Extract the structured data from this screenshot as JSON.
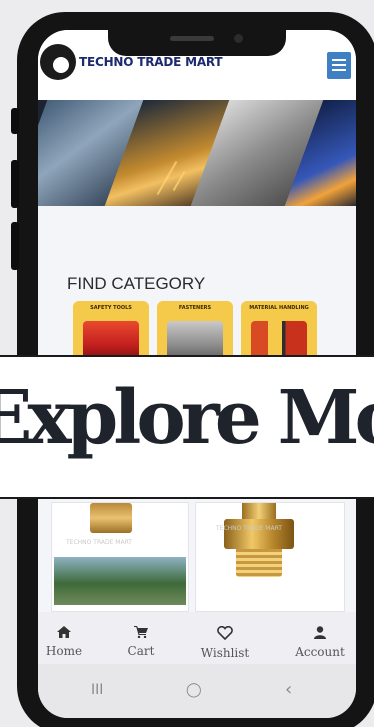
{
  "header": {
    "brand": "TECHNO TRADE MART",
    "logo_icon": "gear-logo-icon",
    "menu_icon": "hamburger-icon"
  },
  "banner": {
    "description_icon": "industrial-banner"
  },
  "categories": {
    "title": "FIND CATEGORY",
    "items": [
      {
        "label": "SAFETY TOOLS"
      },
      {
        "label": "FASTENERS"
      },
      {
        "label": "MATERIAL HANDLING"
      }
    ]
  },
  "products": {
    "watermark": "TECHNO TRADE MART"
  },
  "bottom_nav": {
    "items": [
      {
        "label": "Home",
        "icon": "home-icon"
      },
      {
        "label": "Cart",
        "icon": "cart-icon"
      },
      {
        "label": "Wishlist",
        "icon": "heart-icon"
      },
      {
        "label": "Account",
        "icon": "user-icon"
      }
    ]
  },
  "system_nav": {
    "recents": "III",
    "home": "◯",
    "back": "‹"
  },
  "overlay": {
    "text": "Explore More"
  },
  "colors": {
    "brand": "#1c2a6e",
    "menu": "#3f7fc4",
    "category_card": "#f5c94a"
  }
}
